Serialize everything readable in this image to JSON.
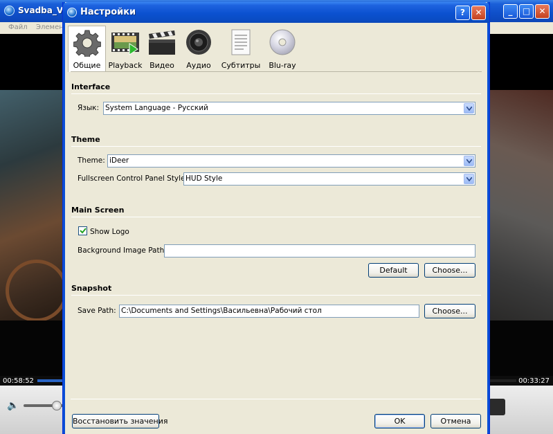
{
  "player": {
    "title": "Svadba_V_",
    "menu": [
      "Файл",
      "Элемен"
    ],
    "time_elapsed": "00:58:52",
    "time_remaining": "00:33:27"
  },
  "dialog": {
    "title": "Настройки",
    "help_icon": "help-icon",
    "close_icon": "close-icon",
    "tabs": [
      {
        "label": "Общие",
        "icon": "gear-icon",
        "active": true
      },
      {
        "label": "Playback",
        "icon": "film-play-icon",
        "active": false
      },
      {
        "label": "Видео",
        "icon": "clapperboard-icon",
        "active": false
      },
      {
        "label": "Аудио",
        "icon": "speaker-icon",
        "active": false
      },
      {
        "label": "Субтитры",
        "icon": "document-icon",
        "active": false
      },
      {
        "label": "Blu-ray",
        "icon": "disc-icon",
        "active": false
      }
    ],
    "interface": {
      "heading": "Interface",
      "language_label": "Язык:",
      "language_value": "System Language - Русский"
    },
    "theme": {
      "heading": "Theme",
      "theme_label": "Theme:",
      "theme_value": "iDeer",
      "fullscreen_label": "Fullscreen Control Panel Style:",
      "fullscreen_value": "HUD Style"
    },
    "main_screen": {
      "heading": "Main Screen",
      "show_logo_label": "Show Logo",
      "show_logo_checked": true,
      "bg_path_label": "Background Image Path:",
      "bg_path_value": "",
      "default_button": "Default",
      "choose_button": "Choose..."
    },
    "snapshot": {
      "heading": "Snapshot",
      "save_path_label": "Save Path:",
      "save_path_value": "C:\\Documents and Settings\\Васильевна\\Рабочий стол",
      "choose_button": "Choose..."
    },
    "footer": {
      "restore_button": "Восстановить значения",
      "ok_button": "OK",
      "cancel_button": "Отмена"
    }
  }
}
